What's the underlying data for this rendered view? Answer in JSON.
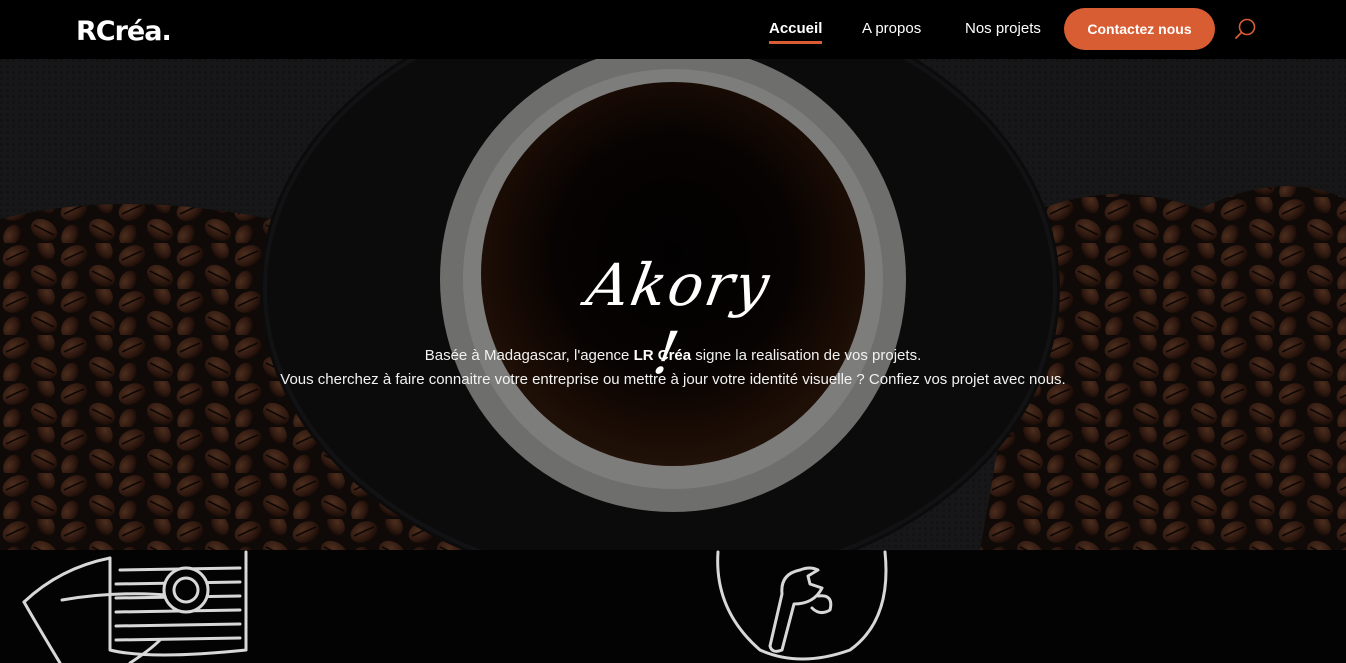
{
  "brand": {
    "logo_text": "RCréa."
  },
  "nav": {
    "home": "Accueil",
    "about": "A propos",
    "projects": "Nos projets",
    "contact": "Contactez nous"
  },
  "hero": {
    "title": "Akory !",
    "line1_before": "Basée à Madagascar, l'agence ",
    "line1_brand": "LR Créa",
    "line1_after": " signe la realisation de vos projets.",
    "line2": "Vous cherchez à faire connaitre votre entreprise ou mettre à jour votre identité visuelle ? Confiez vos projet avec nous."
  },
  "colors": {
    "accent": "#d95d33",
    "background": "#000000"
  },
  "icons": [
    "search-icon",
    "rocket-icon",
    "wrench-bulb-icon"
  ]
}
